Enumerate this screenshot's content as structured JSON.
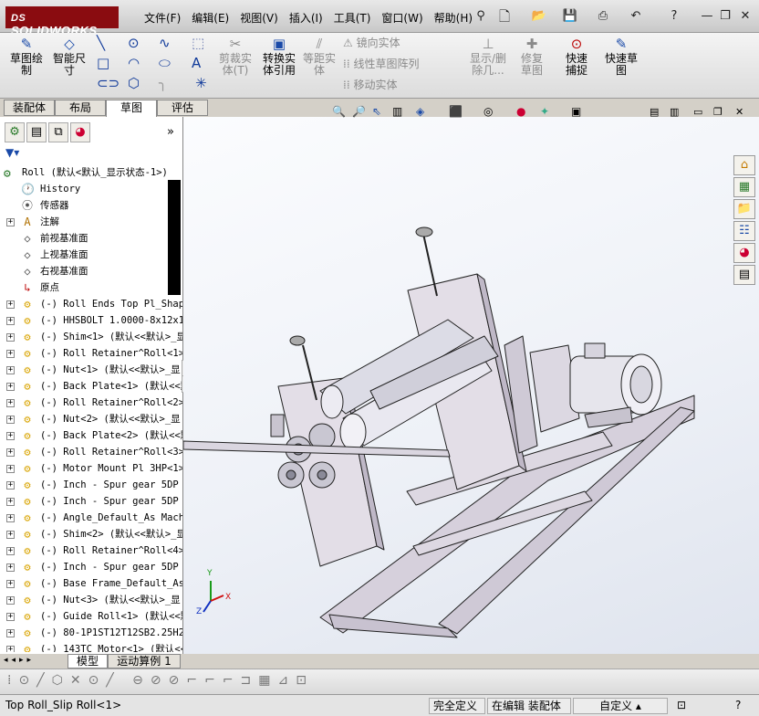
{
  "app": {
    "logo": "SOLIDWORKS"
  },
  "menu": [
    "文件(F)",
    "编辑(E)",
    "视图(V)",
    "插入(I)",
    "工具(T)",
    "窗口(W)",
    "帮助(H)"
  ],
  "ribbon": {
    "sketch": "草图绘制",
    "smart_dim": "智能尺寸",
    "trim": "剪裁实体(T)",
    "convert": "转换实体引用",
    "offset": "等距实体",
    "mirror": "镜向实体",
    "linear_pattern": "线性草图阵列",
    "move": "移动实体",
    "show_delete": "显示/删除几...",
    "repair": "修复草图",
    "quick_snap": "快速捕捉",
    "rapid_sketch": "快速草图"
  },
  "tabs": [
    "装配体",
    "布局",
    "草图",
    "评估"
  ],
  "tree": {
    "root": "Roll  (默认<默认_显示状态-1>)",
    "items": [
      "History",
      "传感器",
      "注解",
      "前视基准面",
      "上视基准面",
      "右视基准面",
      "原点",
      "(-) Roll Ends Top Pl_Shape",
      "(-) HHSBOLT 1.0000-8x12x12",
      "(-) Shim<1> (默认<<默认>_显",
      "(-) Roll Retainer^Roll<1>",
      "(-) Nut<1> (默认<<默认>_显",
      "(-) Back Plate<1> (默认<<默",
      "(-) Roll Retainer^Roll<2>",
      "(-) Nut<2> (默认<<默认>_显",
      "(-) Back Plate<2> (默认<<默",
      "(-) Roll Retainer^Roll<3>",
      "(-) Motor Mount Pl 3HP<1>",
      "(-) Inch - Spur gear 5DP 2",
      "(-) Inch - Spur gear 5DP 2",
      "(-) Angle_Default_As Machi",
      "(-) Shim<2> (默认<<默认>_显",
      "(-) Roll Retainer^Roll<4>",
      "(-) Inch - Spur gear 5DP 2",
      "(-) Base Frame_Default_As",
      "(-) Nut<3> (默认<<默认>_显",
      "(-) Guide Roll<1> (默认<<默",
      "(-) 80-1P1ST12T12SB2.25H2.",
      "(-) 143TC Motor<1> (默认<<"
    ]
  },
  "bottom_tabs": [
    "模型",
    "运动算例 1"
  ],
  "status": {
    "left": "Top Roll_Slip Roll<1>",
    "under_defined": "完全定义",
    "editing": "在编辑 装配体",
    "custom": "自定义"
  },
  "triad": {
    "x": "X",
    "y": "Y",
    "z": "Z"
  },
  "colors": {
    "brand": "#8a0c10",
    "part_icon": "#e7b400",
    "model": "#d9d5de"
  }
}
